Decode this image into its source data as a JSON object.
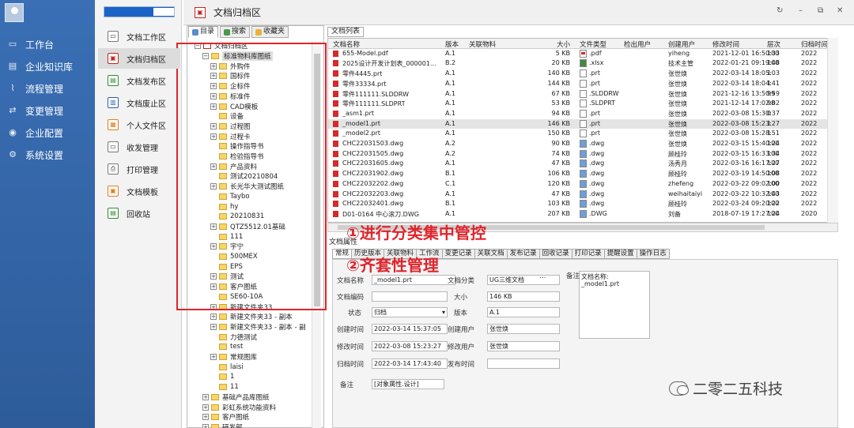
{
  "nav": {
    "items": [
      "工作台",
      "企业知识库",
      "流程管理",
      "变更管理",
      "企业配置",
      "系统设置"
    ],
    "icons": [
      "monitor-icon",
      "book-icon",
      "flow-icon",
      "change-icon",
      "user-icon",
      "gear-icon"
    ]
  },
  "subnav": {
    "items": [
      "文档工作区",
      "文档归档区",
      "文档发布区",
      "文档废止区",
      "个人文件区",
      "收发管理",
      "打印管理",
      "文档模板",
      "回收站"
    ],
    "active": "文档归档区"
  },
  "window": {
    "title": "文档归档区"
  },
  "left_tabs": [
    "目录",
    "搜索",
    "收藏夹"
  ],
  "tree": [
    {
      "label": "文档归档区",
      "indent": 0,
      "pm": "−"
    },
    {
      "label": "标准物料库图纸",
      "indent": 1,
      "pm": "−",
      "sel": true
    },
    {
      "label": "外购件",
      "indent": 2,
      "pm": "+"
    },
    {
      "label": "国标件",
      "indent": 2,
      "pm": "+"
    },
    {
      "label": "企标件",
      "indent": 2,
      "pm": "+"
    },
    {
      "label": "标准件",
      "indent": 2,
      "pm": "+"
    },
    {
      "label": "CAD模板",
      "indent": 2,
      "pm": "+"
    },
    {
      "label": "设备",
      "indent": 2,
      "pm": ""
    },
    {
      "label": "过程图",
      "indent": 2,
      "pm": "+"
    },
    {
      "label": "过程卡",
      "indent": 2,
      "pm": "+"
    },
    {
      "label": "操作指导书",
      "indent": 2,
      "pm": ""
    },
    {
      "label": "检验指导书",
      "indent": 2,
      "pm": ""
    },
    {
      "label": "产品资料",
      "indent": 2,
      "pm": "+"
    },
    {
      "label": "测试20210804",
      "indent": 2,
      "pm": ""
    },
    {
      "label": "长光华大测试图纸",
      "indent": 2,
      "pm": "+"
    },
    {
      "label": "Taybo",
      "indent": 2,
      "pm": ""
    },
    {
      "label": "hy",
      "indent": 2,
      "pm": ""
    },
    {
      "label": "20210831",
      "indent": 2,
      "pm": ""
    },
    {
      "label": "QTZ5512.01基础",
      "indent": 2,
      "pm": "+"
    },
    {
      "label": "111",
      "indent": 2,
      "pm": ""
    },
    {
      "label": "宇宁",
      "indent": 2,
      "pm": "+"
    },
    {
      "label": "500MEX",
      "indent": 2,
      "pm": ""
    },
    {
      "label": "EPS",
      "indent": 2,
      "pm": ""
    },
    {
      "label": "测试",
      "indent": 2,
      "pm": "+"
    },
    {
      "label": "客户图纸",
      "indent": 2,
      "pm": "+"
    },
    {
      "label": "SE60-10A",
      "indent": 2,
      "pm": ""
    },
    {
      "label": "新建文件夹33",
      "indent": 2,
      "pm": "+"
    },
    {
      "label": "新建文件夹33 - 副本",
      "indent": 2,
      "pm": "+"
    },
    {
      "label": "新建文件夹33 - 副本 - 副",
      "indent": 2,
      "pm": "+"
    },
    {
      "label": "力德测试",
      "indent": 2,
      "pm": ""
    },
    {
      "label": "test",
      "indent": 2,
      "pm": ""
    },
    {
      "label": "常规图库",
      "indent": 2,
      "pm": "+"
    },
    {
      "label": "laisi",
      "indent": 2,
      "pm": ""
    },
    {
      "label": "1",
      "indent": 2,
      "pm": ""
    },
    {
      "label": "11",
      "indent": 2,
      "pm": ""
    },
    {
      "label": "基础产品库图纸",
      "indent": 1,
      "pm": "+"
    },
    {
      "label": "彩虹系统功能资料",
      "indent": 1,
      "pm": "+"
    },
    {
      "label": "客户图纸",
      "indent": 1,
      "pm": "+"
    },
    {
      "label": "研发部",
      "indent": 1,
      "pm": "+"
    }
  ],
  "file_list": {
    "tab": "文档列表",
    "columns": [
      "文档名称",
      "版本",
      "关联物料",
      "大小",
      "文件类型",
      "检出用户",
      "创建用户",
      "修改时间",
      "层次",
      "归档时间"
    ],
    "rows": [
      [
        "655-Model.pdf",
        "A.1",
        "",
        "5 KB",
        ".pdf",
        "",
        "yiheng",
        "2021-12-01 16:50:33",
        "100",
        "2022"
      ],
      [
        "2025设计开发计划表_000001...",
        "B.2",
        "",
        "20 KB",
        ".xlsx",
        "",
        "技术主管",
        "2022-01-21 09:19:48",
        "100",
        "2022"
      ],
      [
        "零件4445.prt",
        "A.1",
        "",
        "140 KB",
        ".prt",
        "",
        "张世焕",
        "2022-03-14 18:05:03",
        "1",
        "2022"
      ],
      [
        "零件33334.prt",
        "A.1",
        "",
        "144 KB",
        ".prt",
        "",
        "张世焕",
        "2022-03-14 18:04:41",
        "1",
        "2022"
      ],
      [
        "零件111111.SLDDRW",
        "A.1",
        "",
        "67 KB",
        ".SLDDRW",
        "",
        "张世焕",
        "2021-12-16 13:50:59",
        "99",
        "2022"
      ],
      [
        "零件111111.SLDPRT",
        "A.1",
        "",
        "53 KB",
        ".SLDPRT",
        "",
        "张世焕",
        "2021-12-14 17:02:02",
        "98",
        "2022"
      ],
      [
        "_asm1.prt",
        "A.1",
        "",
        "94 KB",
        ".prt",
        "",
        "张世焕",
        "2022-03-08 15:30:37",
        "0",
        "2022"
      ],
      [
        "_model1.prt",
        "A.1",
        "",
        "146 KB",
        ".prt",
        "",
        "张世焕",
        "2022-03-08 15:23:27",
        "1",
        "2022"
      ],
      [
        "_model2.prt",
        "A.1",
        "",
        "150 KB",
        ".prt",
        "",
        "张世焕",
        "2022-03-08 15:28:51",
        "1",
        "2022"
      ],
      [
        "CHC22031503.dwg",
        "A.2",
        "",
        "90 KB",
        ".dwg",
        "",
        "张世焕",
        "2022-03-15 15:40:24",
        "100",
        "2022"
      ],
      [
        "CHC22031505.dwg",
        "A.2",
        "",
        "74 KB",
        ".dwg",
        "",
        "顾桂玲",
        "2022-03-15 16:33:34",
        "100",
        "2022"
      ],
      [
        "CHC22031605.dwg",
        "A.1",
        "",
        "47 KB",
        ".dwg",
        "",
        "汤秀月",
        "2022-03-16 16:17:27",
        "100",
        "2022"
      ],
      [
        "CHC22031902.dwg",
        "B.1",
        "",
        "106 KB",
        ".dwg",
        "",
        "顾桂玲",
        "2022-03-19 14:50:08",
        "100",
        "2022"
      ],
      [
        "CHC22032202.dwg",
        "C.1",
        "",
        "120 KB",
        ".dwg",
        "",
        "zhefeng",
        "2022-03-22 09:02:00",
        "100",
        "2022"
      ],
      [
        "CHC22032203.dwg",
        "A.1",
        "",
        "47 KB",
        ".dwg",
        "",
        "weihaitaiyi",
        "2022-03-22 10:32:43",
        "100",
        "2022"
      ],
      [
        "CHC22032401.dwg",
        "B.1",
        "",
        "103 KB",
        ".dwg",
        "",
        "顾桂玲",
        "2022-03-24 09:20:22",
        "100",
        "2022"
      ],
      [
        "D01-0164 中心滚刀.DWG",
        "A.1",
        "",
        "207 KB",
        ".DWG",
        "",
        "刘备",
        "2018-07-19 17:27:24",
        "100",
        "2020"
      ]
    ]
  },
  "props": {
    "title": "文档属性",
    "tabs": [
      "常规",
      "历史版本",
      "关联物料",
      "工作流",
      "变更记录",
      "关联文档",
      "发布记录",
      "回收记录",
      "打印记录",
      "提醒设置",
      "操作日志"
    ],
    "labels": {
      "name": "文档名称",
      "category": "文档分类",
      "note": "备注",
      "code": "文档编码",
      "size": "大小",
      "status": "状态",
      "version": "版本",
      "created": "创建时间",
      "creator": "创建用户",
      "modified": "修改时间",
      "modifier": "修改用户",
      "archived": "归档时间",
      "publish": "发布时间",
      "remark": "备注"
    },
    "values": {
      "name": "_model1.prt",
      "category": "UG三维文档",
      "code": "",
      "size": "146 KB",
      "status": "归档",
      "version": "A.1",
      "created": "2022-03-14 15:37:05",
      "creator": "张世焕",
      "modified": "2022-03-08 15:23:27",
      "modifier": "张世焕",
      "archived": "2022-03-14 17:43:40",
      "publish": "",
      "remark": "[对象属性.设计]"
    },
    "note_text": "文档名称:\n_model1.prt"
  },
  "annotations": {
    "a1": "①进行分类集中管控",
    "a2": "②齐套性管理"
  },
  "watermark": "二零二五科技"
}
